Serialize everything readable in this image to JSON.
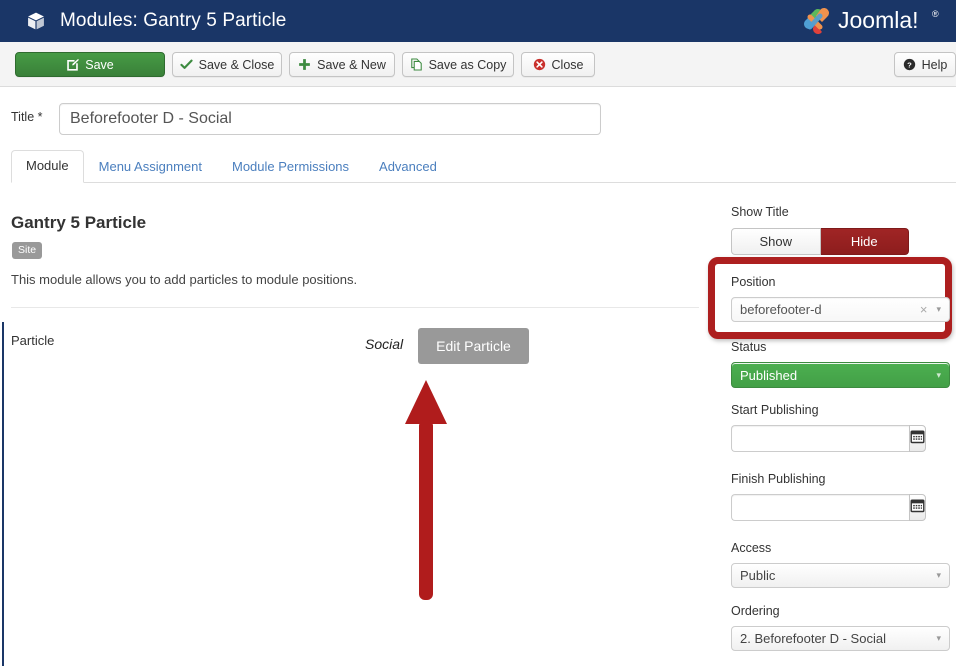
{
  "header": {
    "title": "Modules: Gantry 5 Particle",
    "icon": "cube-icon",
    "brand": "Joomla!"
  },
  "toolbar": {
    "save": "Save",
    "save_close": "Save & Close",
    "save_new": "Save & New",
    "save_copy": "Save as Copy",
    "close": "Close",
    "help": "Help"
  },
  "title_field": {
    "label": "Title *",
    "value": "Beforefooter D - Social",
    "placeholder": ""
  },
  "tabs": [
    {
      "label": "Module",
      "active": true
    },
    {
      "label": "Menu Assignment",
      "active": false
    },
    {
      "label": "Module Permissions",
      "active": false
    },
    {
      "label": "Advanced",
      "active": false
    }
  ],
  "main": {
    "module_heading": "Gantry 5 Particle",
    "badge": "Site",
    "description": "This module allows you to add particles to module positions.",
    "particle_label": "Particle",
    "particle_value": "Social",
    "edit_particle_button": "Edit Particle"
  },
  "sidebar": {
    "show_title": {
      "label": "Show Title",
      "options": [
        "Show",
        "Hide"
      ],
      "selected": "Hide"
    },
    "position": {
      "label": "Position",
      "value": "beforefooter-d",
      "clear_icon": "×",
      "caret_icon": "▾"
    },
    "status": {
      "label": "Status",
      "value": "Published"
    },
    "start_publishing": {
      "label": "Start Publishing",
      "value": "",
      "calendar_icon": "calendar-icon"
    },
    "finish_publishing": {
      "label": "Finish Publishing",
      "value": "",
      "calendar_icon": "calendar-icon"
    },
    "access": {
      "label": "Access",
      "value": "Public"
    },
    "ordering": {
      "label": "Ordering",
      "value": "2. Beforefooter D - Social"
    }
  },
  "annotations": {
    "highlight_color": "#ad1f1f",
    "arrow_color": "#b01c1c",
    "arrow_target": "Position"
  },
  "colors": {
    "header_blue": "#1a3667",
    "save_green": "#3a8039",
    "published_green": "#43a047",
    "hide_red": "#8d1d1d",
    "tab_link_blue": "#4b7fbe"
  }
}
